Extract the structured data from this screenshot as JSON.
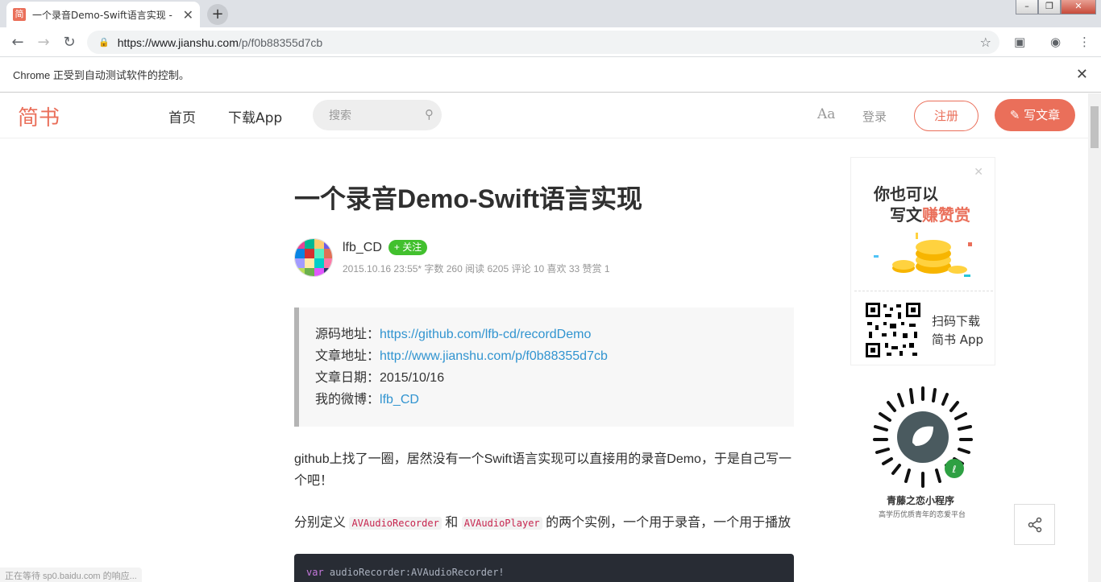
{
  "browser": {
    "tab_title": "一个录音Demo-Swift语言实现 -",
    "tab_favicon": "简",
    "url_host": "https://www.jianshu.com",
    "url_path": "/p/f0b88355d7cb",
    "infobar_text": "Chrome 正受到自动测试软件的控制。",
    "status_text": "正在等待 sp0.baidu.com 的响应..."
  },
  "header": {
    "logo": "简书",
    "nav_home": "首页",
    "nav_download": "下载App",
    "search_placeholder": "搜索",
    "font_toggle": "Aa",
    "login": "登录",
    "register": "注册",
    "write": "写文章"
  },
  "article": {
    "title": "一个录音Demo-Swift语言实现",
    "author": "lfb_CD",
    "follow": "关注",
    "meta": "2015.10.16 23:55*  字数 260  阅读 6205  评论 10  喜欢 33  赞赏 1",
    "quote": {
      "source_label": "源码地址：",
      "source_link": "https://github.com/lfb-cd/recordDemo",
      "article_label": "文章地址：",
      "article_link": "http://www.jianshu.com/p/f0b88355d7cb",
      "date_label": "文章日期：",
      "date_value": "2015/10/16",
      "weibo_label": "我的微博：",
      "weibo_link": "lfb_CD"
    },
    "para1": "github上找了一圈，居然没有一个Swift语言实现可以直接用的录音Demo，于是自己写一个吧！",
    "para2_a": "分别定义 ",
    "para2_code1": "AVAudioRecorder",
    "para2_b": " 和 ",
    "para2_code2": "AVAudioPlayer",
    "para2_c": " 的两个实例，一个用于录音，一个用于播放",
    "code_kw": "var",
    "code_rest": " audioRecorder:AVAudioRecorder!"
  },
  "sidebar": {
    "ad_line1": "你也可以",
    "ad_line2a": "写文",
    "ad_line2b": "赚赞赏",
    "qr_line1": "扫码下载",
    "qr_line2": "简书 App",
    "mp_title": "青藤之恋小程序",
    "mp_sub": "高学历优质青年的恋爱平台"
  },
  "colors": {
    "brand": "#ea6f5a",
    "follow": "#42c02e",
    "link": "#3194d0"
  }
}
